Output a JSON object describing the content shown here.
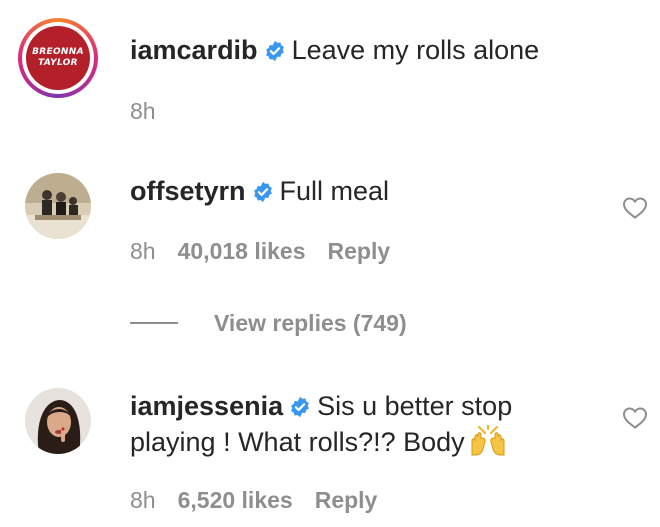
{
  "comments": [
    {
      "username": "iamcardib",
      "avatar_text_line1": "BREONNA",
      "avatar_text_line2": "TAYLOR",
      "text": "Leave my rolls alone",
      "time": "8h"
    },
    {
      "username": "offsetyrn",
      "text": "Full meal",
      "time": "8h",
      "likes": "40,018 likes",
      "reply": "Reply"
    },
    {
      "username": "iamjessenia",
      "text_line1": "Sis u better stop",
      "text_line2": "playing ! What rolls?!? Body",
      "time": "8h",
      "likes": "6,520 likes",
      "reply": "Reply"
    }
  ],
  "view_replies": "View replies (749)",
  "colors": {
    "verified": "#3897f0",
    "muted": "#8e8e8e",
    "text": "#262626",
    "avatar_red": "#b3202a"
  },
  "icons": {
    "verified": "verified-badge-icon",
    "heart": "heart-outline-icon",
    "emoji": "raising-hands-emoji"
  }
}
